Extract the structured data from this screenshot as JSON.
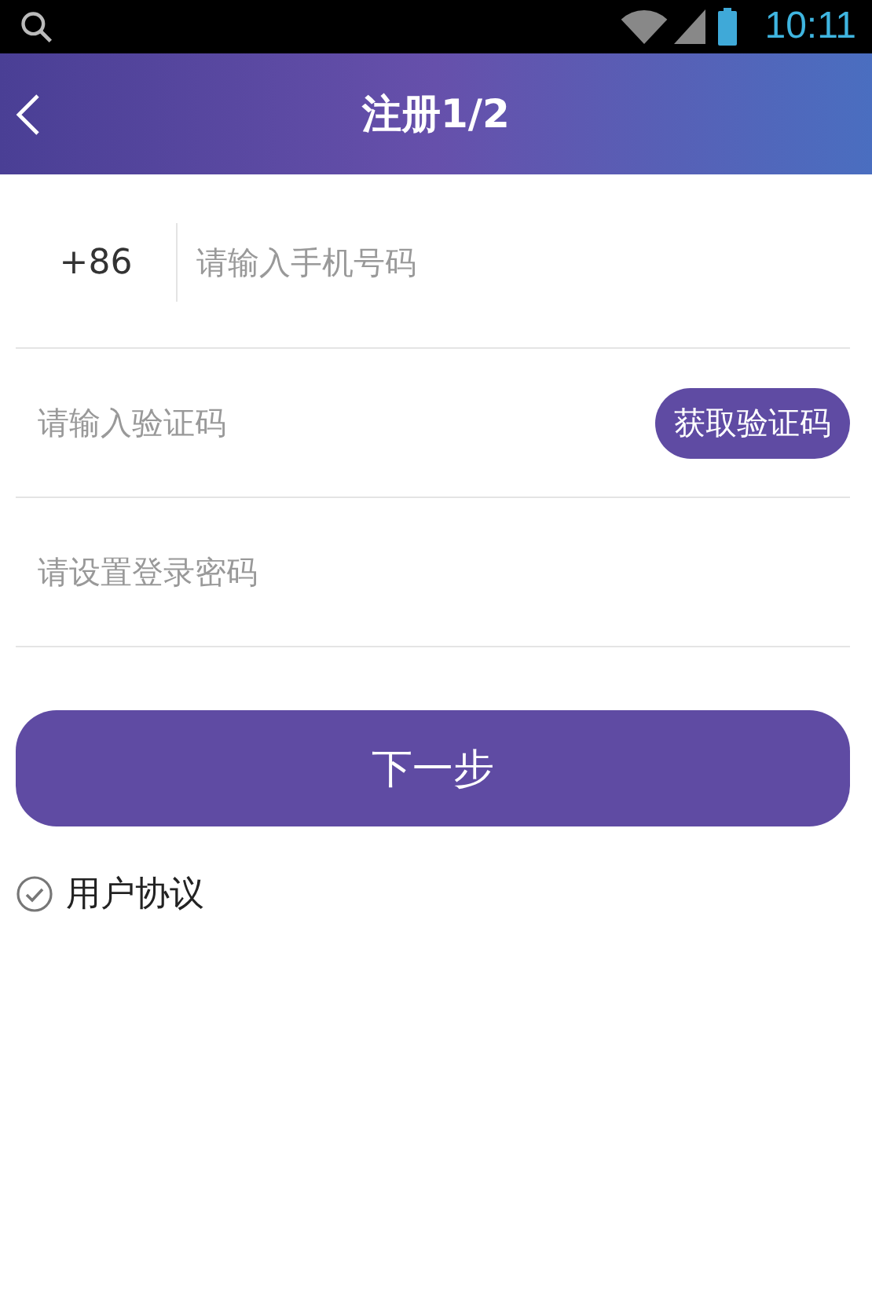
{
  "status_bar": {
    "time": "10:11"
  },
  "header": {
    "title": "注册1/2"
  },
  "phone": {
    "country_code": "+86",
    "placeholder": "请输入手机号码"
  },
  "code": {
    "placeholder": "请输入验证码",
    "button": "获取验证码"
  },
  "password": {
    "placeholder": "请设置登录密码"
  },
  "next_button": "下一步",
  "agreement": {
    "label": "用户协议",
    "checked": true
  }
}
